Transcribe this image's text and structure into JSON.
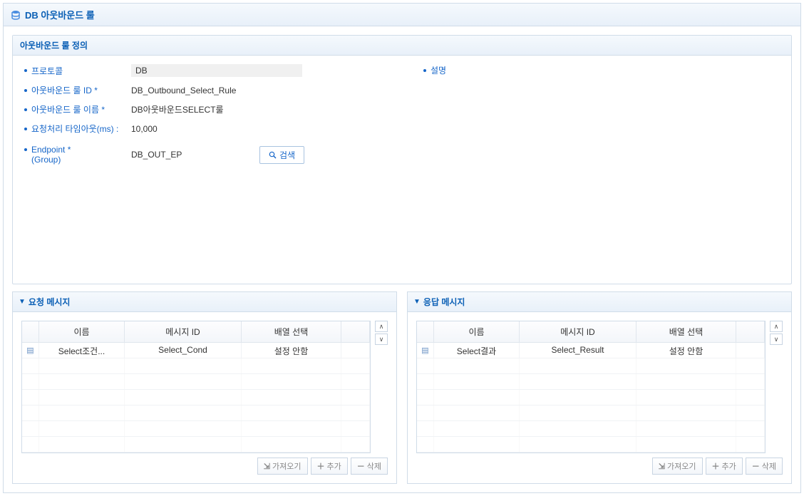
{
  "page": {
    "title": "DB 아웃바운드 룰"
  },
  "definition": {
    "title": "아웃바운드 룰 정의",
    "fields": {
      "protocol_label": "프로토콜",
      "protocol_value": "DB",
      "id_label": "아웃바운드 룰 ID *",
      "id_value": "DB_Outbound_Select_Rule",
      "name_label": "아웃바운드 룰 이름 *",
      "name_value": "DB아웃바운드SELECT룰",
      "timeout_label": "요청처리 타임아웃(ms) :",
      "timeout_value": "10,000",
      "endpoint_label_1": "Endpoint *",
      "endpoint_label_2": "(Group)",
      "endpoint_value": "DB_OUT_EP",
      "search_label": "검색",
      "desc_label": "설명"
    }
  },
  "request": {
    "title": "요청 메시지",
    "columns": {
      "c1": "이름",
      "c2": "메시지 ID",
      "c3": "배열 선택"
    },
    "row": {
      "name": "Select조건...",
      "msgid": "Select_Cond",
      "array": "설정 안함"
    }
  },
  "response": {
    "title": "응답 메시지",
    "columns": {
      "c1": "이름",
      "c2": "메시지 ID",
      "c3": "배열 선택"
    },
    "row": {
      "name": "Select결과",
      "msgid": "Select_Result",
      "array": "설정 안함"
    }
  },
  "buttons": {
    "import": "가져오기",
    "add": "추가",
    "delete": "삭제"
  }
}
